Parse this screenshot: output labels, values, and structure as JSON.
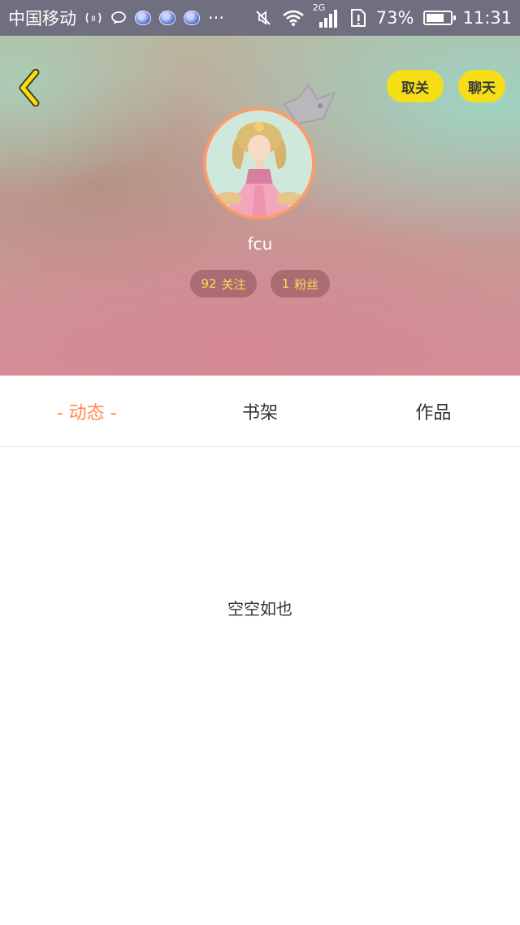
{
  "status_bar": {
    "carrier": "中国移动",
    "battery_percent": "73%",
    "battery_level": 0.73,
    "time": "11:31",
    "network": "2G",
    "more": "···"
  },
  "header": {
    "unfollow_label": "取关",
    "chat_label": "聊天",
    "username": "fcu",
    "following_count": "92",
    "following_label": "关注",
    "followers_count": "1",
    "followers_label": "粉丝"
  },
  "tabs": [
    {
      "label": "- 动态 -",
      "active": true
    },
    {
      "label": "书架",
      "active": false
    },
    {
      "label": "作品",
      "active": false
    }
  ],
  "content": {
    "empty_message": "空空如也"
  },
  "colors": {
    "accent_orange": "#ff8a4a",
    "button_yellow": "#f5de16",
    "stat_text_yellow": "#ffd95a",
    "status_bar": "#6f6f7f"
  }
}
